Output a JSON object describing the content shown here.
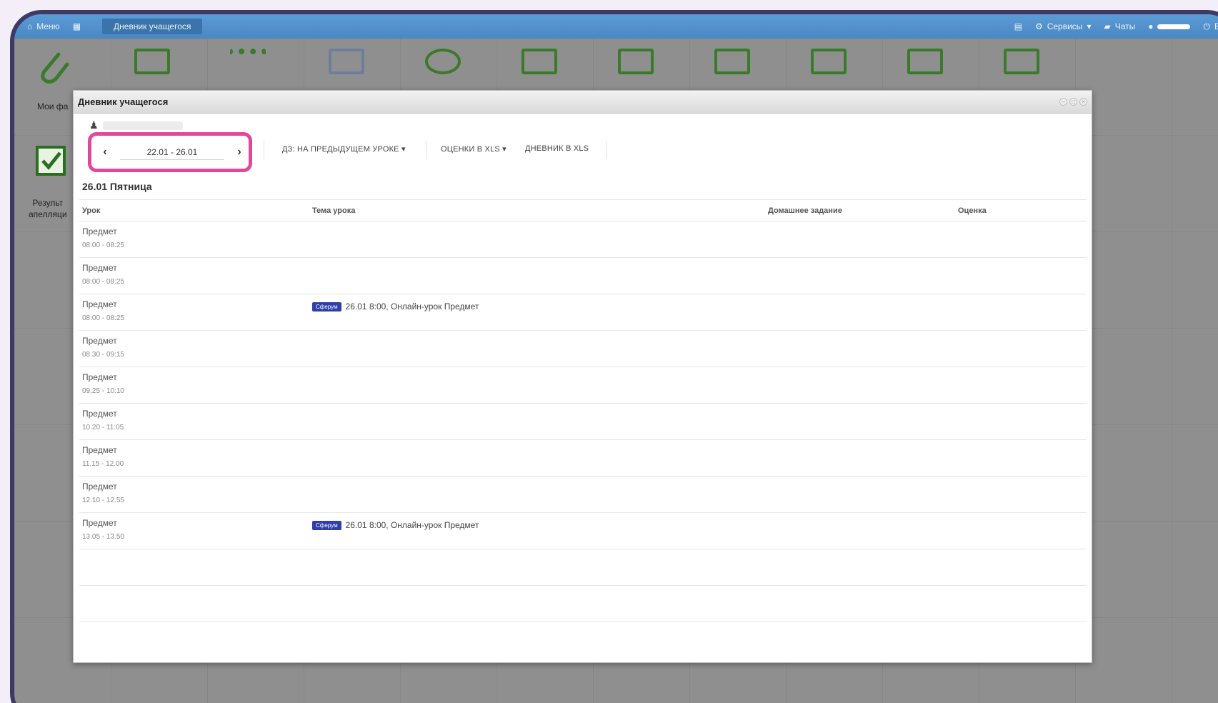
{
  "topbar": {
    "menu_label": "Меню",
    "active_tab": "Дневник учащегося",
    "services_label": "Сервисы",
    "chats_label": "Чаты",
    "exit_label": "В"
  },
  "desktop": {
    "my_files_label": "Мои фа",
    "results_label_1": "Результ",
    "results_label_2": "апелляци"
  },
  "window": {
    "title": "Дневник учащегося",
    "week_range": "22.01 - 26.01",
    "hw_dropdown": "ДЗ: НА ПРЕДЫДУЩЕМ УРОКЕ ▾",
    "grades_xls": "ОЦЕНКИ В XLS ▾",
    "diary_xls": "ДНЕВНИК В XLS",
    "day_title": "26.01 Пятница"
  },
  "table": {
    "headers": {
      "lesson": "Урок",
      "topic": "Тема урока",
      "homework": "Домашнее задание",
      "grade": "Оценка"
    },
    "rows": [
      {
        "subject": "Предмет",
        "time": "08:00 - 08:25",
        "badge": "",
        "topic": ""
      },
      {
        "subject": "Предмет",
        "time": "08:00 - 08:25",
        "badge": "",
        "topic": ""
      },
      {
        "subject": "Предмет",
        "time": "08:00 - 08:25",
        "badge": "Сферум",
        "topic": "26.01 8:00, Онлайн-урок Предмет"
      },
      {
        "subject": "Предмет",
        "time": "08.30 - 09:15",
        "badge": "",
        "topic": ""
      },
      {
        "subject": "Предмет",
        "time": "09.25 - 10:10",
        "badge": "",
        "topic": ""
      },
      {
        "subject": "Предмет",
        "time": "10.20 - 11:05",
        "badge": "",
        "topic": ""
      },
      {
        "subject": "Предмет",
        "time": "11.15 - 12.00",
        "badge": "",
        "topic": ""
      },
      {
        "subject": "Предмет",
        "time": "12.10 - 12.55",
        "badge": "",
        "topic": ""
      },
      {
        "subject": "Предмет",
        "time": "13.05 - 13.50",
        "badge": "Сферум",
        "topic": "26.01 8:00, Онлайн-урок Предмет"
      }
    ]
  },
  "colors": {
    "topbar": "#4a88c4",
    "highlight": "#e2479b",
    "badge": "#2f3ea8",
    "frame": "#3e3a63"
  }
}
